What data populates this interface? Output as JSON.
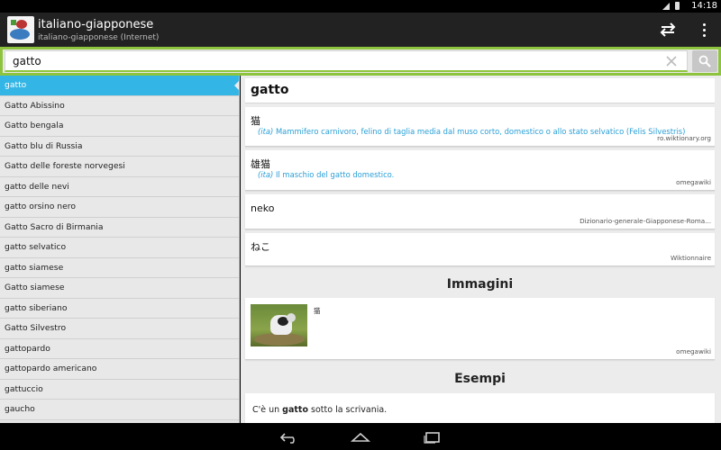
{
  "status": {
    "time": "14:18"
  },
  "app": {
    "title": "italiano-giapponese",
    "subtitle": "italiano-giapponese (Internet)"
  },
  "search": {
    "value": "gatto",
    "placeholder": ""
  },
  "word_list": [
    "gatto",
    "Gatto Abissino",
    "Gatto bengala",
    "Gatto blu di Russia",
    "Gatto delle foreste norvegesi",
    "gatto delle nevi",
    "gatto orsino nero",
    "Gatto Sacro di Birmania",
    "gatto selvatico",
    "gatto siamese",
    "Gatto siamese",
    "gatto siberiano",
    "Gatto Silvestro",
    "gattopardo",
    "gattopardo americano",
    "gattuccio",
    "gaucho"
  ],
  "entry": {
    "headword": "gatto",
    "translations": [
      {
        "term": "猫",
        "lang": "(ita)",
        "definition": "Mammifero carnivoro, felino di taglia media dal muso corto, domestico o allo stato selvatico (Felis Silvestris)",
        "source": "ro.wiktionary.org"
      },
      {
        "term": "雄猫",
        "lang": "(ita)",
        "definition": "Il maschio del gatto domestico.",
        "source": "omegawiki"
      },
      {
        "term": "neko",
        "lang": "",
        "definition": "",
        "source": "Dizionario-generale-Giapponese-Roma..."
      },
      {
        "term": "ねこ",
        "lang": "",
        "definition": "",
        "source": "Wiktionnaire"
      }
    ],
    "images_title": "Immagini",
    "image": {
      "caption": "猫",
      "source": "omegawiki"
    },
    "examples_title": "Esempi",
    "example": {
      "before": "C'è un ",
      "bold": "gatto",
      "after": " sotto la scrivania."
    }
  },
  "icons": {
    "swap": "swap-icon",
    "menu": "overflow-menu-icon",
    "clear": "clear-icon",
    "search": "search-icon",
    "back": "back-icon",
    "home": "home-icon",
    "recents": "recents-icon"
  },
  "colors": {
    "accent": "#33b5e5",
    "search_border": "#8ec43d",
    "definition": "#2a9fd6",
    "actionbar": "#222222"
  }
}
